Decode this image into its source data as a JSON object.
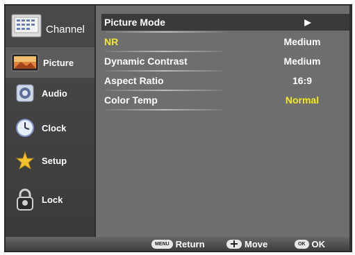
{
  "sidebar": {
    "items": [
      {
        "label": "Channel",
        "icon": "channel-icon",
        "selected": false
      },
      {
        "label": "Picture",
        "icon": "picture-icon",
        "selected": true
      },
      {
        "label": "Audio",
        "icon": "audio-icon",
        "selected": false
      },
      {
        "label": "Clock",
        "icon": "clock-icon",
        "selected": false
      },
      {
        "label": "Setup",
        "icon": "setup-icon",
        "selected": false
      },
      {
        "label": "Lock",
        "icon": "lock-icon",
        "selected": false
      }
    ]
  },
  "menu": {
    "rows": [
      {
        "label": "Picture Mode",
        "value": "▶"
      },
      {
        "label": "NR",
        "value": "Medium"
      },
      {
        "label": "Dynamic Contrast",
        "value": "Medium"
      },
      {
        "label": "Aspect Ratio",
        "value": "16:9"
      },
      {
        "label": "Color Temp",
        "value": "Normal"
      }
    ]
  },
  "footer": {
    "menu_key": "MENU",
    "return_label": "Return",
    "move_label": "Move",
    "ok_key": "OK",
    "ok_label": "OK"
  },
  "colors": {
    "highlight_text": "#f2e82a",
    "panel_bg": "#6e6e6e",
    "sidebar_bg": "#444444"
  }
}
